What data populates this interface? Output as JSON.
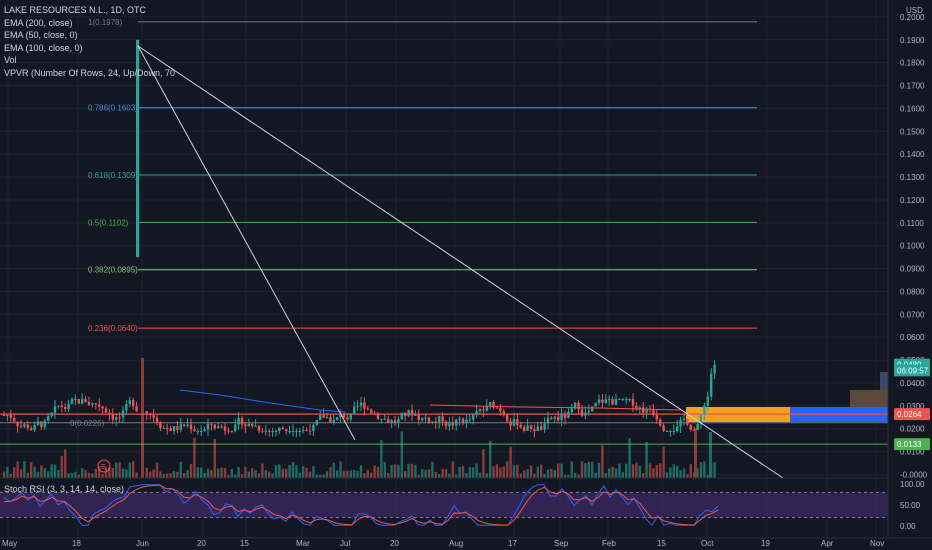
{
  "legend": {
    "symbol": "LAKE RESOURCES N.L., 1D, OTC",
    "lines": [
      "EMA (200, close)",
      "EMA (50, close, 0)",
      "EMA (100, close, 0)",
      "Vol",
      "VPVR (Number Of Rows, 24, Up/Down, 70"
    ]
  },
  "stoch_label": "Stoch RSI (3, 3, 14, 14, close)",
  "colors": {
    "background": "#131722",
    "grid": "#1e222d",
    "up": "#26a69a",
    "down": "#ef5350",
    "vol_up": "#1b6d64",
    "vol_down": "#8a3b3b",
    "trendline": "#d1d4dc",
    "vpvr_up": "#2962ff",
    "vpvr_down": "#f2a31a",
    "stoch_k": "#2962ff",
    "stoch_d": "#ef5350",
    "stoch_band": "#4a2d7a"
  },
  "chart_data": {
    "type": "candlestick",
    "currency": "USD",
    "price_axis": {
      "min": -0.0,
      "max": 0.2,
      "ticks": [
        "0.2100",
        "0.2000",
        "0.1900",
        "0.1800",
        "0.1700",
        "0.1600",
        "0.1500",
        "0.1400",
        "0.1300",
        "0.1200",
        "0.1100",
        "0.1000",
        "0.0900",
        "0.0800",
        "0.0700",
        "0.0600",
        "0.0500",
        "0.0400",
        "0.0300",
        "0.0200",
        "0.0100",
        "-0.0000"
      ]
    },
    "time_axis": [
      "Feb",
      "Mar",
      "Apr",
      "20",
      "May",
      "18",
      "Jun",
      "15",
      "Jul",
      "20",
      "Aug",
      "17",
      "Sep",
      "15",
      "Oct",
      "19",
      "Nov"
    ],
    "fib_levels": [
      {
        "label": "1(0.1978)",
        "value": 0.1978,
        "color": "#787b86"
      },
      {
        "label": "0.786(0.1603)",
        "value": 0.1603,
        "color": "#4a90e2"
      },
      {
        "label": "0.618(0.1309)",
        "value": 0.1309,
        "color": "#26a69a"
      },
      {
        "label": "0.5(0.1102)",
        "value": 0.1102,
        "color": "#4caf50"
      },
      {
        "label": "0.382(0.0895)",
        "value": 0.0895,
        "color": "#81c784"
      },
      {
        "label": "0.236(0.0640)",
        "value": 0.064,
        "color": "#ef5350"
      },
      {
        "label": "0(0.0226)",
        "value": 0.0226,
        "color": "#787b86"
      }
    ],
    "price_tags": [
      {
        "label": "0.0480",
        "value": 0.048,
        "color": "#26a69a"
      },
      {
        "label": "06:09:57",
        "value": 0.0455,
        "color": "#26a69a"
      },
      {
        "label": "0.0264",
        "value": 0.0264,
        "color": "#ef5350"
      },
      {
        "label": "0.0133",
        "value": 0.0133,
        "color": "#4caf50"
      }
    ],
    "spike": {
      "date_label": "Apr",
      "high": 0.19,
      "low": 0.095
    },
    "stoch_rsi": {
      "ticks": [
        "100.00",
        "50.00",
        "0.00"
      ],
      "upper": 80,
      "lower": 20
    }
  }
}
